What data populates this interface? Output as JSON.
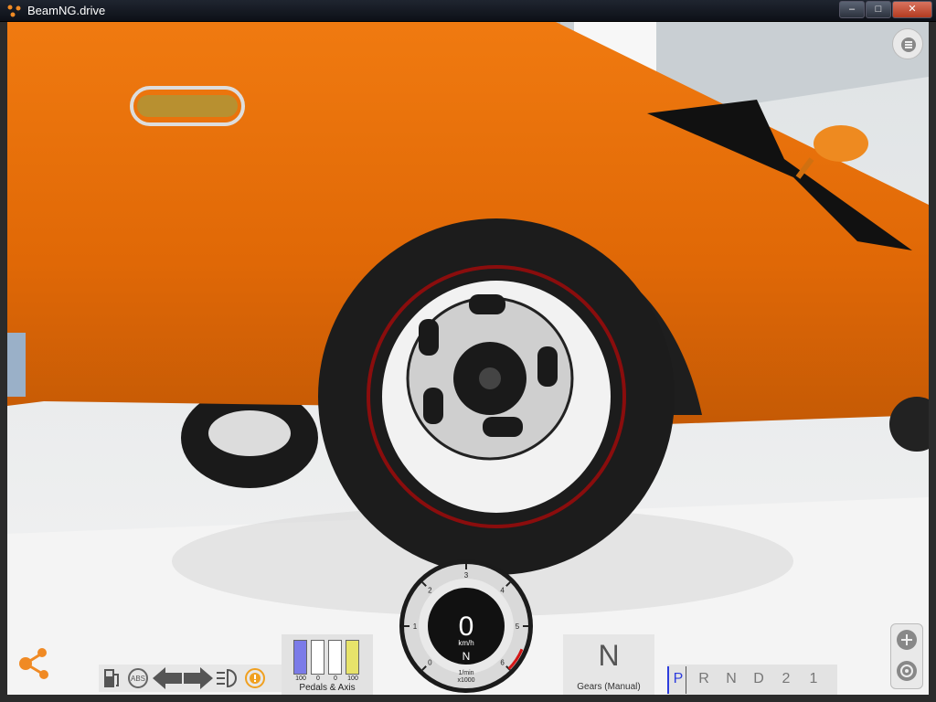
{
  "window": {
    "title": "BeamNG.drive"
  },
  "status_icons": [
    "fuel-icon",
    "abs-icon",
    "turn-left-icon",
    "turn-right-icon",
    "headlight-icon",
    "hazard-icon"
  ],
  "status_labels": {
    "abs": "ABS"
  },
  "pedals": {
    "label": "Pedals & Axis",
    "values": [
      "100",
      "0",
      "0",
      "100"
    ],
    "levels": [
      1.0,
      0,
      0,
      1.0
    ],
    "colors": [
      "#7b7be8",
      "#ffffff",
      "#ffffff",
      "#e7e36a"
    ]
  },
  "speedometer": {
    "speed": "0",
    "unit": "km/h",
    "gear": "N",
    "rpm_unit_line1": "1/min",
    "rpm_unit_line2": "x1000",
    "ticks": [
      "0",
      "1",
      "2",
      "3",
      "4",
      "5",
      "6"
    ]
  },
  "gears": {
    "current": "N",
    "label": "Gears (Manual)"
  },
  "selector": {
    "items": [
      "P",
      "R",
      "N",
      "D",
      "2",
      "1"
    ],
    "active": "P"
  },
  "colors": {
    "car_body": "#e8700c",
    "accent": "#2d3cdd"
  }
}
